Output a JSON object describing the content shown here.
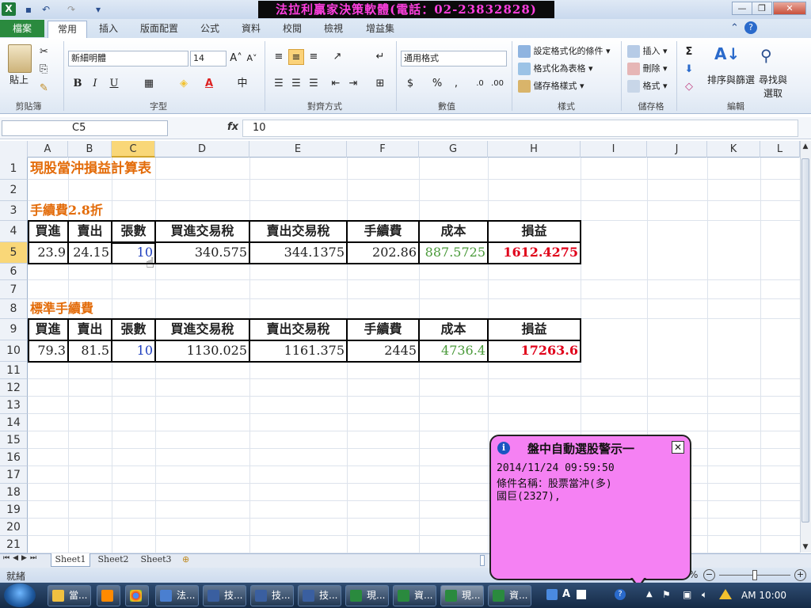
{
  "window": {
    "title": "法拉利贏家決策軟體(電話：02-23832828)",
    "minimize": "—",
    "restore": "❐",
    "close": "✕"
  },
  "tabs": [
    "檔案",
    "常用",
    "插入",
    "版面配置",
    "公式",
    "資料",
    "校閱",
    "檢視",
    "增益集"
  ],
  "ribbon": {
    "clipboard": {
      "paste": "貼上",
      "group": "剪貼簿"
    },
    "font": {
      "name": "新細明體",
      "size": "14",
      "bold": "B",
      "italic": "I",
      "underline": "U",
      "grow": "A˄",
      "shrink": "A˅",
      "group": "字型"
    },
    "alignment": {
      "group": "對齊方式"
    },
    "number": {
      "format": "通用格式",
      "currency": "$",
      "percent": "%",
      "comma": ",",
      "group": "數值"
    },
    "styles": {
      "conditional": "設定格式化的條件",
      "as_table": "格式化為表格",
      "cell_styles": "儲存格樣式",
      "group": "樣式"
    },
    "cells": {
      "insert": "插入",
      "delete": "刪除",
      "format": "格式",
      "group": "儲存格"
    },
    "editing": {
      "sum": "Σ",
      "sort": "排序與篩選",
      "find": "尋找與選取",
      "group": "編輯"
    }
  },
  "formula_bar": {
    "name_box": "C5",
    "fx": "fx",
    "content": "10"
  },
  "columns": [
    "A",
    "B",
    "C",
    "D",
    "E",
    "F",
    "G",
    "H",
    "I",
    "J",
    "K",
    "L"
  ],
  "rows": [
    "1",
    "2",
    "3",
    "4",
    "5",
    "6",
    "7",
    "8",
    "9",
    "10",
    "11",
    "12",
    "13",
    "14",
    "15",
    "16",
    "17",
    "18",
    "19",
    "20",
    "21"
  ],
  "sheet": {
    "title": "現股當沖損益計算表",
    "section1_label": "手續費2.8折",
    "section2_label": "標準手續費",
    "headers": [
      "買進",
      "賣出",
      "張數",
      "買進交易稅",
      "賣出交易稅",
      "手續費",
      "成本",
      "損益"
    ],
    "row5": [
      "23.9",
      "24.15",
      "10",
      "340.575",
      "344.1375",
      "202.86",
      "887.5725",
      "1612.4275"
    ],
    "row10": [
      "79.3",
      "81.5",
      "10",
      "1130.025",
      "1161.375",
      "2445",
      "4736.4",
      "17263.6"
    ]
  },
  "sheet_tabs": [
    "Sheet1",
    "Sheet2",
    "Sheet3"
  ],
  "status": {
    "ready": "就緒",
    "zoom_fragment": "%"
  },
  "popup": {
    "title": "盤中自動選股警示一",
    "close": "✕",
    "time": "2014/11/24 09:59:50",
    "condition": "條件名稱：股票當沖(多)",
    "stock": "國巨(2327),"
  },
  "taskbar": {
    "items": [
      "當...",
      "",
      "",
      "法...",
      "技...",
      "技...",
      "技...",
      "現...",
      "資...",
      "現...",
      "資..."
    ],
    "clock": "AM 10:00"
  },
  "colors": {
    "orange": "#e36c0a",
    "blue": "#1f3fbf",
    "green": "#4a9a3a",
    "red": "#e0001a",
    "popup": "#f581f3"
  }
}
